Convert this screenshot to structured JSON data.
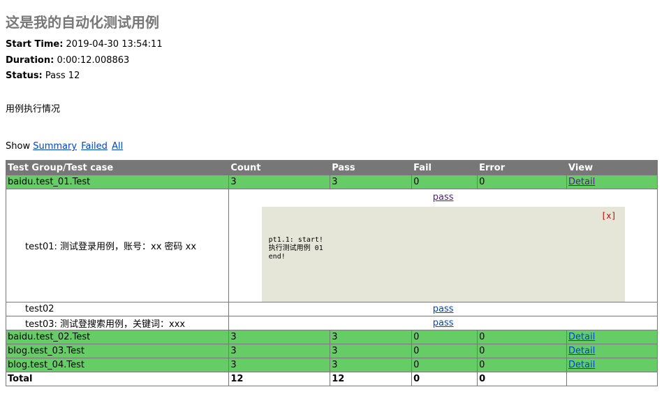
{
  "report": {
    "title": "这是我的自动化测试用例",
    "start_time_label": "Start Time:",
    "start_time": "2019-04-30 13:54:11",
    "duration_label": "Duration:",
    "duration": "0:00:12.008863",
    "status_label": "Status:",
    "status": "Pass 12",
    "description": "用例执行情况"
  },
  "filter": {
    "label": "Show",
    "summary": "Summary",
    "failed": "Failed",
    "all": "All"
  },
  "table": {
    "headers": [
      "Test Group/Test case",
      "Count",
      "Pass",
      "Fail",
      "Error",
      "View"
    ],
    "groups": [
      {
        "name": "baidu.test_01.Test",
        "count": "3",
        "pass": "3",
        "fail": "0",
        "error": "0",
        "view": "Detail"
      },
      {
        "name": "baidu.test_02.Test",
        "count": "3",
        "pass": "3",
        "fail": "0",
        "error": "0",
        "view": "Detail"
      },
      {
        "name": "blog.test_03.Test",
        "count": "3",
        "pass": "3",
        "fail": "0",
        "error": "0",
        "view": "Detail"
      },
      {
        "name": "blog.test_04.Test",
        "count": "3",
        "pass": "3",
        "fail": "0",
        "error": "0",
        "view": "Detail"
      }
    ],
    "cases": [
      {
        "name": "test01: 测试登录用例，账号：xx 密码 xx",
        "result": "pass"
      },
      {
        "name": "test02",
        "result": "pass"
      },
      {
        "name": "test03: 测试登搜索用例，关键词：xxx",
        "result": "pass"
      }
    ],
    "popup": {
      "close": "[x]",
      "output": "pt1.1: start!\n执行测试用例 01\nend!"
    },
    "total": {
      "label": "Total",
      "count": "12",
      "pass": "12",
      "fail": "0",
      "error": "0"
    }
  },
  "colors": {
    "header_bg": "#777777",
    "pass_group_bg": "#66cc66",
    "popup_bg": "#e5e6d8",
    "link": "#0044cc",
    "visited_link": "#551a8b",
    "close_red": "#cc0000"
  }
}
